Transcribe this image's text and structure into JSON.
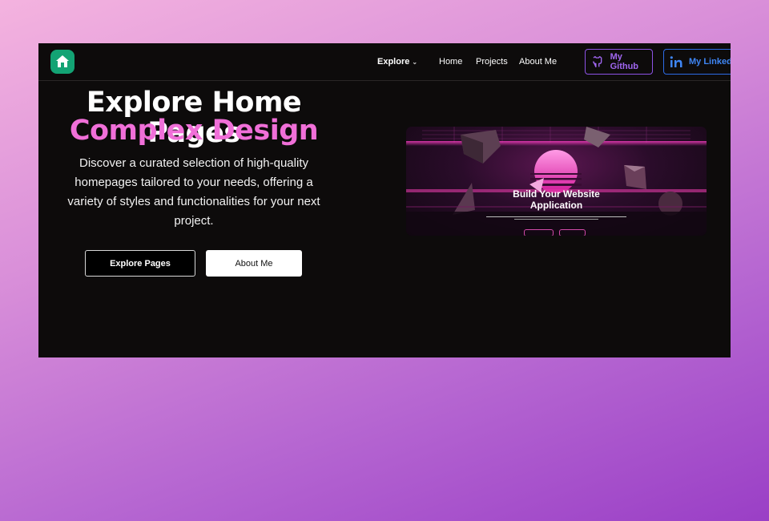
{
  "navbar": {
    "logo_icon": "house-icon",
    "explore_label": "Explore",
    "explore_icon": "chevron-down-icon",
    "home_label": "Home",
    "projects_label": "Projects",
    "about_label": "About Me",
    "github_label": "My Github",
    "github_icon": "github-icon",
    "linkedin_label": "My LinkedI",
    "linkedin_icon": "linkedin-icon"
  },
  "hero": {
    "title": "Explore Home Pages",
    "subtitle": "Complex Design",
    "description": "Discover a curated selection of high-quality homepages tailored to your needs, offering a variety of styles and functionalities for your next project.",
    "explore_button": "Explore Pages",
    "about_button": "About Me"
  },
  "preview": {
    "title_line1": "Build Your Website",
    "title_line2": "Application"
  },
  "colors": {
    "background_dark": "#0d0b0b",
    "accent_pink": "#f06fd8",
    "github_purple": "#8d52e6",
    "linkedin_blue": "#2d6be6",
    "logo_green": "#13a374"
  }
}
